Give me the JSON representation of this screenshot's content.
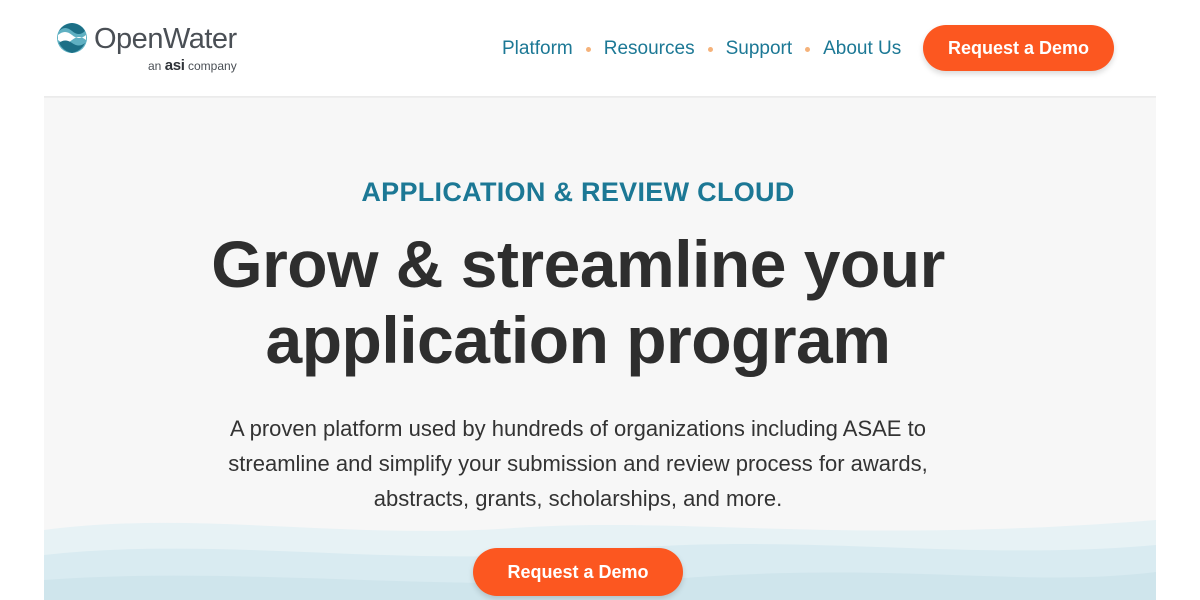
{
  "header": {
    "logo": {
      "name": "OpenWater",
      "tagline_prefix": "an",
      "tagline_brand": "asi",
      "tagline_suffix": "company"
    },
    "nav": [
      {
        "label": "Platform"
      },
      {
        "label": "Resources"
      },
      {
        "label": "Support"
      },
      {
        "label": "About Us"
      }
    ],
    "cta_label": "Request a Demo"
  },
  "hero": {
    "eyebrow": "APPLICATION & REVIEW CLOUD",
    "headline_line1": "Grow & streamline your",
    "headline_line2": "application program",
    "description_line1": "A proven platform used by hundreds of organizations including ASAE to",
    "description_line2": "streamline and simplify your submission and review process for awards,",
    "description_line3": "abstracts, grants, scholarships, and more.",
    "cta_label": "Request a Demo"
  },
  "colors": {
    "accent_teal": "#1c7895",
    "cta_orange": "#fc5720",
    "nav_dot": "#f5b27a",
    "heading": "#2e2e2e",
    "wave": "#dcedf2"
  },
  "icons": {
    "logo_mark": "openwater-wave-logo-icon"
  }
}
